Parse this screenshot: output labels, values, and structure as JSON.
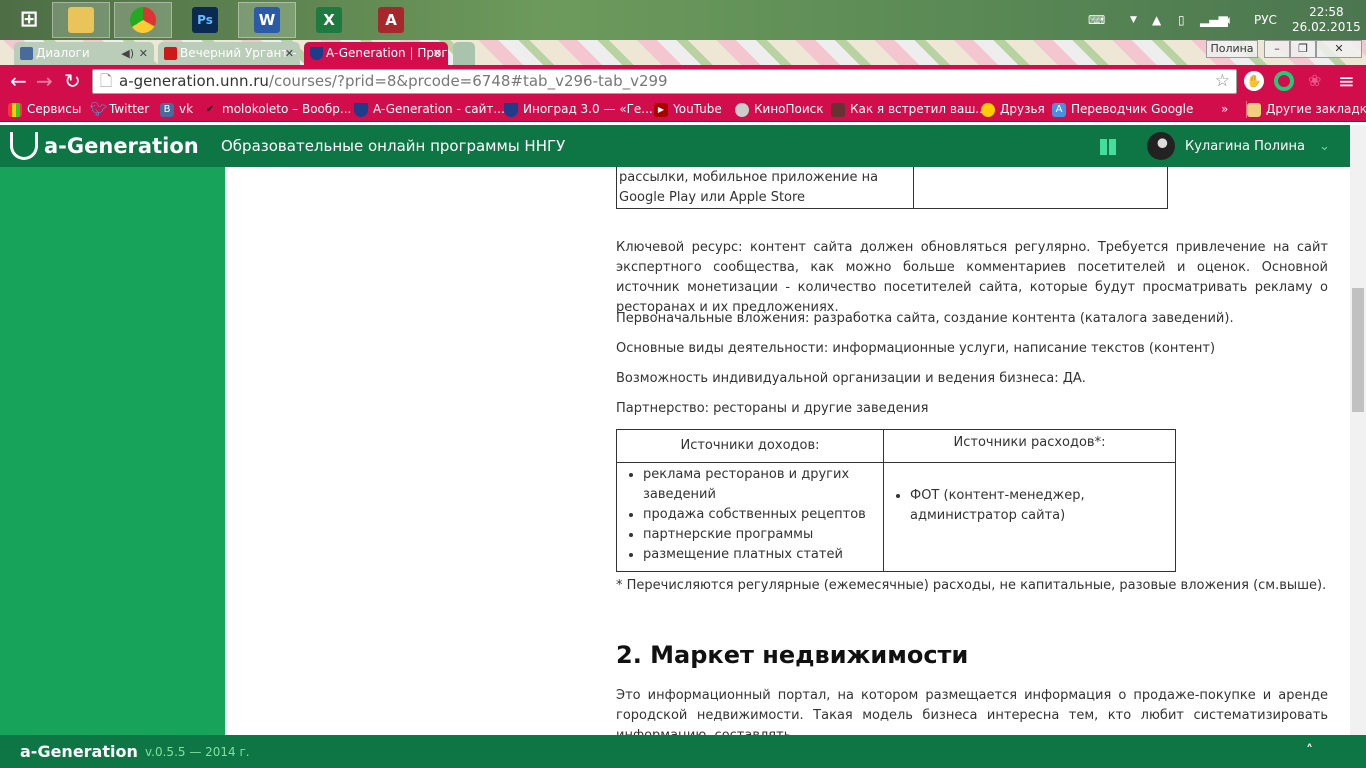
{
  "taskbar": {
    "apps": [
      "Windows",
      "Explorer",
      "Chrome",
      "Photoshop",
      "Word",
      "Excel",
      "Access"
    ],
    "app_letters": [
      "Ps",
      "W",
      "X",
      "A"
    ],
    "language": "РУС",
    "time": "22:58",
    "date": "26.02.2015"
  },
  "browser": {
    "profile": "Полина",
    "tabs": [
      {
        "title": "Диалоги",
        "color": "#4a6a9a"
      },
      {
        "title": "Вечерний Ургант - Григо",
        "color": "#cc1a1a"
      },
      {
        "title": "A-Generation | Программ",
        "color": "#1d3c8a"
      }
    ],
    "url_host": "a-generation.unn.ru",
    "url_path": "/courses/?prid=8&prcode=6748#tab_v296-tab_v299",
    "bookmarks": [
      "Сервисы",
      "Twitter",
      "vk",
      "molokoleto – Вообр...",
      "A-Generation - сайт...",
      "Иноград 3.0 — «Ге...",
      "YouTube",
      "КиноПоиск",
      "Как я встретил ваш...",
      "Друзья",
      "Переводчик Google"
    ],
    "bookmarks_more": "»",
    "other_bookmarks": "Другие закладки"
  },
  "header": {
    "logo": "a-Generation",
    "subtitle": "Образовательные онлайн программы ННГУ",
    "user": "Кулагина Полина"
  },
  "content": {
    "top_table_cell": "рассылки, мобильное приложение на Google Play или Apple Store",
    "paragraphs": [
      "Ключевой ресурс: контент сайта должен обновляться регулярно. Требуется привлечение на сайт экспертного сообщества, как можно больше комментариев посетителей и оценок. Основной источник монетизации - количество посетителей сайта, которые будут просматривать рекламу о ресторанах и их предложениях.",
      "Первоначальные вложения: разработка сайта, создание контента (каталога заведений).",
      "Основные виды деятельности: информационные услуги, написание текстов (контент)",
      "Возможность индивидуальной организации и ведения бизнеса: ДА.",
      "Партнерство: рестораны и другие заведения"
    ],
    "table": {
      "income_header": "Источники доходов:",
      "expense_header": "Источники расходов*:",
      "income": [
        "реклама ресторанов и других заведений",
        "продажа собственных рецептов",
        "партнерские программы",
        "размещение платных статей"
      ],
      "expense": [
        "ФОТ (контент-менеджер, администратор сайта)"
      ]
    },
    "footnote": "* Перечисляются регулярные (ежемесячные) расходы, не капитальные, разовые вложения (см.выше).",
    "section_title": "2. Маркет недвижимости",
    "section_text": "Это информационный портал, на котором размещается информация о продаже-покупке и аренде городской недвижимости. Такая модель бизнеса интересна тем, кто любит систематизировать информацию, составлять"
  },
  "footer": {
    "logo": "a-Generation",
    "version": "v.0.5.5 — 2014 г.",
    "up": "˄"
  }
}
